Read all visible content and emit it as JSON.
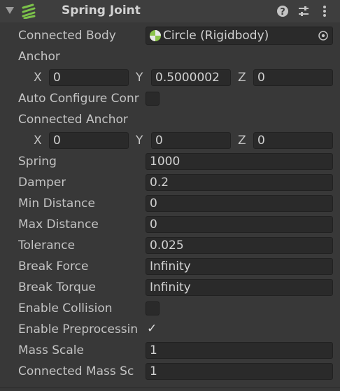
{
  "header": {
    "title": "Spring Joint",
    "icon": "spring-joint-icon",
    "help_icon": "help-icon",
    "preset_icon": "presets-icon",
    "menu_icon": "kebab-menu-icon"
  },
  "fields": {
    "connected_body": {
      "label": "Connected Body",
      "value": "Circle (Rigidbody)"
    },
    "anchor": {
      "label": "Anchor",
      "x_label": "X",
      "x": "0",
      "y_label": "Y",
      "y": "0.5000002",
      "z_label": "Z",
      "z": "0"
    },
    "auto_configure": {
      "label": "Auto Configure Conr",
      "checked": false
    },
    "connected_anchor": {
      "label": "Connected Anchor",
      "x_label": "X",
      "x": "0",
      "y_label": "Y",
      "y": "0",
      "z_label": "Z",
      "z": "0"
    },
    "spring": {
      "label": "Spring",
      "value": "1000"
    },
    "damper": {
      "label": "Damper",
      "value": "0.2"
    },
    "min_distance": {
      "label": "Min Distance",
      "value": "0"
    },
    "max_distance": {
      "label": "Max Distance",
      "value": "0"
    },
    "tolerance": {
      "label": "Tolerance",
      "value": "0.025"
    },
    "break_force": {
      "label": "Break Force",
      "value": "Infinity"
    },
    "break_torque": {
      "label": "Break Torque",
      "value": "Infinity"
    },
    "enable_collision": {
      "label": "Enable Collision",
      "checked": false
    },
    "enable_preprocessing": {
      "label": "Enable Preprocessin",
      "checked": true,
      "check_glyph": "✓"
    },
    "mass_scale": {
      "label": "Mass Scale",
      "value": "1"
    },
    "connected_mass_scale": {
      "label": "Connected Mass Sc",
      "value": "1"
    }
  },
  "colors": {
    "background": "#383838",
    "field": "#2a2a2a",
    "text": "#c4c4c4",
    "accent_green": "#8bc34a"
  }
}
